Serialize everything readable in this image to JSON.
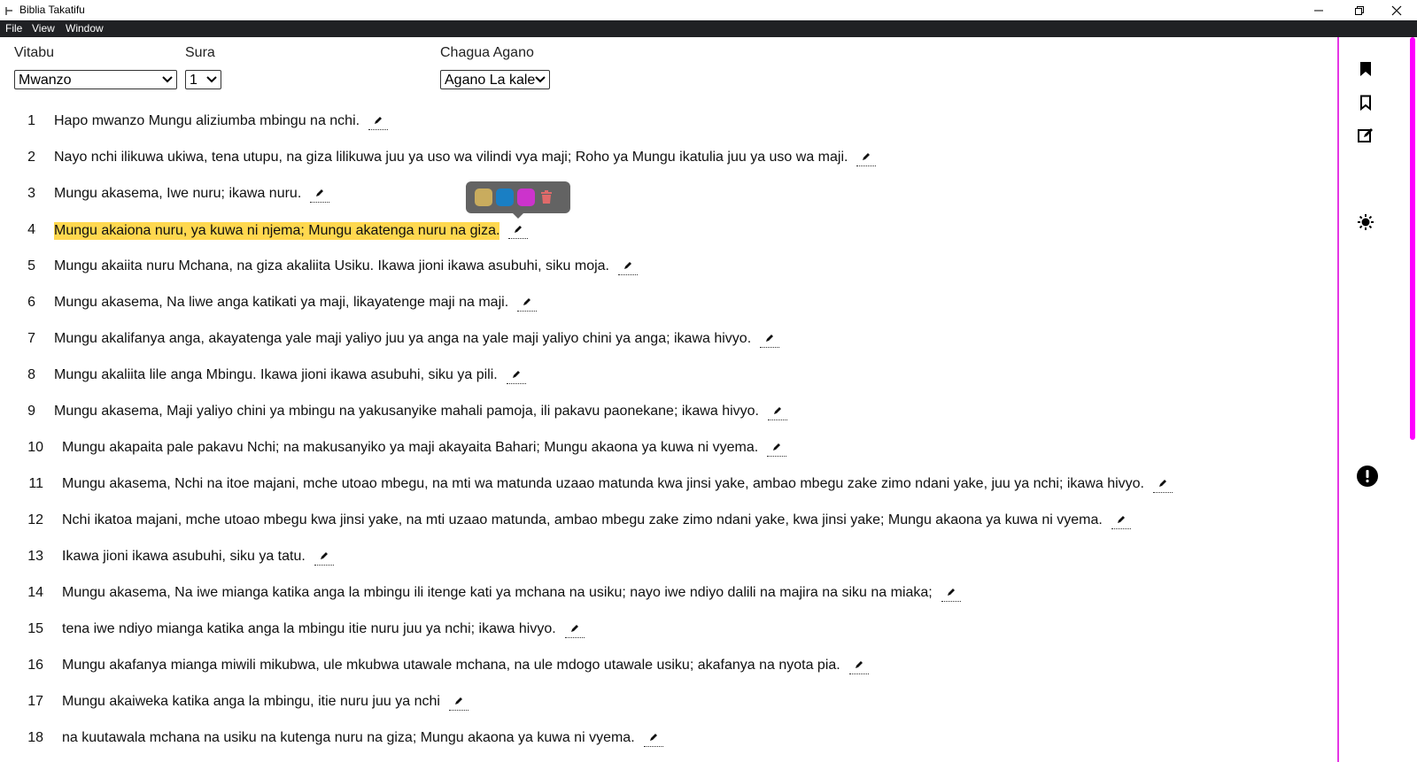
{
  "window": {
    "title": "Biblia Takatifu"
  },
  "menu": [
    "File",
    "View",
    "Window"
  ],
  "controls": {
    "books_label": "Vitabu",
    "book_value": "Mwanzo",
    "chapter_label": "Sura",
    "chapter_value": "1",
    "testament_label": "Chagua Agano",
    "testament_value": "Agano La kale"
  },
  "highlight_colors": [
    "#c9ac5e",
    "#1a7fc4",
    "#cc33cc"
  ],
  "highlighted_verse_color": "#ffd84f",
  "accent_color": "#ff00ff",
  "verses": [
    {
      "n": "1",
      "text": "Hapo mwanzo Mungu aliziumba mbingu na nchi."
    },
    {
      "n": "2",
      "text": "Nayo nchi ilikuwa ukiwa, tena utupu, na giza lilikuwa juu ya uso wa vilindi vya maji; Roho ya Mungu ikatulia juu ya uso wa maji."
    },
    {
      "n": "3",
      "text": "Mungu akasema, Iwe nuru; ikawa nuru."
    },
    {
      "n": "4",
      "text": "Mungu akaiona nuru, ya kuwa ni njema; Mungu akatenga nuru na giza."
    },
    {
      "n": "5",
      "text": "Mungu akaiita nuru Mchana, na giza akaliita Usiku. Ikawa jioni ikawa asubuhi, siku moja."
    },
    {
      "n": "6",
      "text": "Mungu akasema, Na liwe anga katikati ya maji, likayatenge maji na maji."
    },
    {
      "n": "7",
      "text": "Mungu akalifanya anga, akayatenga yale maji yaliyo juu ya anga na yale maji yaliyo chini ya anga; ikawa hivyo."
    },
    {
      "n": "8",
      "text": "Mungu akaliita lile anga Mbingu. Ikawa jioni ikawa asubuhi, siku ya pili."
    },
    {
      "n": "9",
      "text": "Mungu akasema, Maji yaliyo chini ya mbingu na yakusanyike mahali pamoja, ili pakavu paonekane; ikawa hivyo."
    },
    {
      "n": "10",
      "text": "Mungu akapaita pale pakavu Nchi; na makusanyiko ya maji akayaita Bahari; Mungu akaona ya kuwa ni vyema."
    },
    {
      "n": "11",
      "text": "Mungu akasema, Nchi na itoe majani, mche utoao mbegu, na mti wa matunda uzaao matunda kwa jinsi yake, ambao mbegu zake zimo ndani yake, juu ya nchi; ikawa hivyo."
    },
    {
      "n": "12",
      "text": "Nchi ikatoa majani, mche utoao mbegu kwa jinsi yake, na mti uzaao matunda, ambao mbegu zake zimo ndani yake, kwa jinsi yake; Mungu akaona ya kuwa ni vyema."
    },
    {
      "n": "13",
      "text": "Ikawa jioni ikawa asubuhi, siku ya tatu."
    },
    {
      "n": "14",
      "text": "Mungu akasema, Na iwe mianga katika anga la mbingu ili itenge kati ya mchana na usiku; nayo iwe ndiyo dalili na majira na siku na miaka;"
    },
    {
      "n": "15",
      "text": "tena iwe ndiyo mianga katika anga la mbingu itie nuru juu ya nchi; ikawa hivyo."
    },
    {
      "n": "16",
      "text": "Mungu akafanya mianga miwili mikubwa, ule mkubwa utawale mchana, na ule mdogo utawale usiku; akafanya na nyota pia."
    },
    {
      "n": "17",
      "text": "Mungu akaiweka katika anga la mbingu, itie nuru juu ya nchi"
    },
    {
      "n": "18",
      "text": "na kuutawala mchana na usiku na kutenga nuru na giza; Mungu akaona ya kuwa ni vyema."
    }
  ]
}
